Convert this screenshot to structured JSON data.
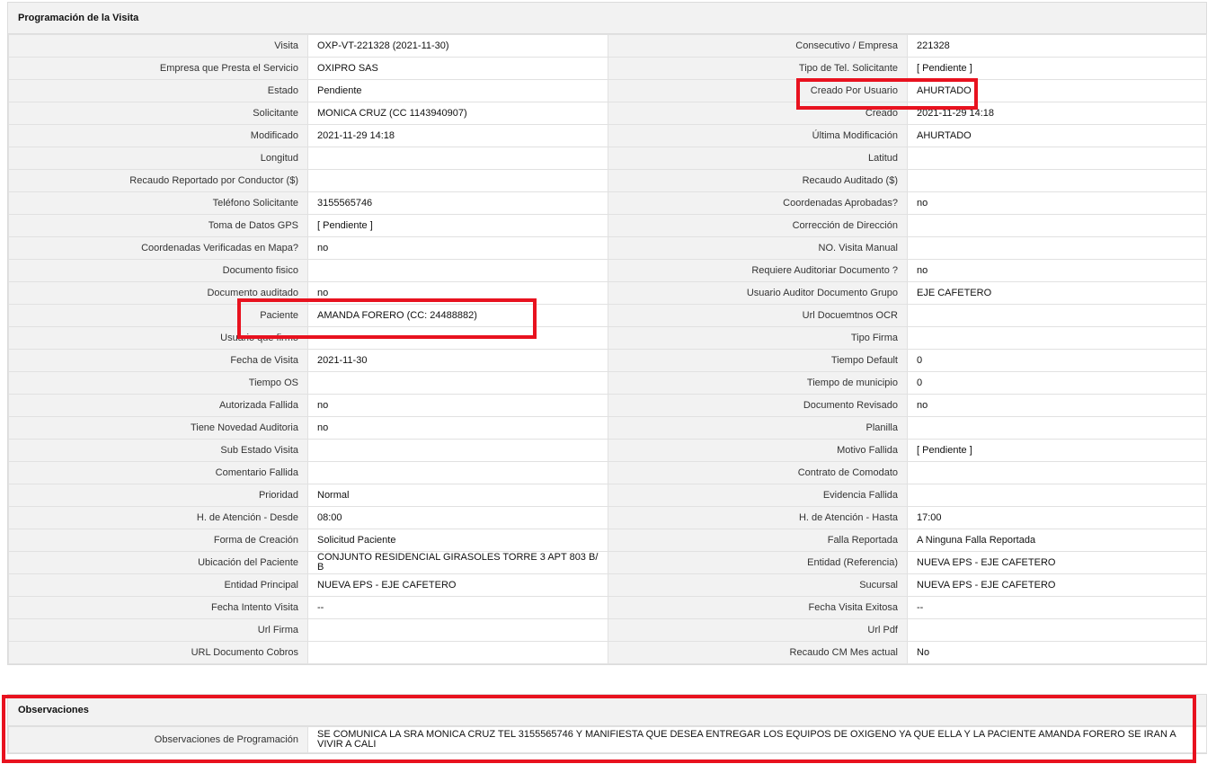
{
  "visit_panel": {
    "title": "Programación de la Visita",
    "rows": [
      {
        "l1": "Visita",
        "v1": "OXP-VT-221328 (2021-11-30)",
        "l2": "Consecutivo / Empresa",
        "v2": "221328"
      },
      {
        "l1": "Empresa que Presta el Servicio",
        "v1": "OXIPRO SAS",
        "l2": "Tipo de Tel. Solicitante",
        "v2": "[ Pendiente ]"
      },
      {
        "l1": "Estado",
        "v1": "Pendiente",
        "l2": "Creado Por Usuario",
        "v2": "AHURTADO"
      },
      {
        "l1": "Solicitante",
        "v1": "MONICA CRUZ (CC 1143940907)",
        "l2": "Creado",
        "v2": "2021-11-29 14:18"
      },
      {
        "l1": "Modificado",
        "v1": "2021-11-29 14:18",
        "l2": "Última Modificación",
        "v2": " AHURTADO"
      },
      {
        "l1": "Longitud",
        "v1": "",
        "l2": "Latitud",
        "v2": ""
      },
      {
        "l1": "Recaudo Reportado por Conductor ($)",
        "v1": "",
        "l2": "Recaudo Auditado ($)",
        "v2": ""
      },
      {
        "l1": "Teléfono Solicitante",
        "v1": "3155565746",
        "l2": "Coordenadas Aprobadas?",
        "v2": " no"
      },
      {
        "l1": "Toma de Datos GPS",
        "v1": "[ Pendiente ]",
        "l2": "Corrección de Dirección",
        "v2": ""
      },
      {
        "l1": "Coordenadas Verificadas en Mapa?",
        "v1": " no",
        "l2": "NO. Visita Manual",
        "v2": ""
      },
      {
        "l1": "Documento fisico",
        "v1": "",
        "l2": "Requiere Auditoriar Documento ?",
        "v2": " no"
      },
      {
        "l1": "Documento auditado",
        "v1": " no",
        "l2": "Usuario Auditor Documento Grupo",
        "v2": "EJE CAFETERO"
      },
      {
        "l1": "Paciente",
        "v1": "AMANDA FORERO (CC: 24488882)",
        "l2": "Url Docuemtnos OCR",
        "v2": ""
      },
      {
        "l1": "Usuario que firmo",
        "v1": "",
        "l2": "Tipo Firma",
        "v2": ""
      },
      {
        "l1": "Fecha de Visita",
        "v1": " 2021-11-30",
        "l2": "Tiempo Default",
        "v2": "0"
      },
      {
        "l1": "Tiempo OS",
        "v1": "",
        "l2": "Tiempo de municipio",
        "v2": "0"
      },
      {
        "l1": "Autorizada Fallida",
        "v1": " no",
        "l2": "Documento Revisado",
        "v2": " no"
      },
      {
        "l1": "Tiene Novedad Auditoria",
        "v1": " no",
        "l2": "Planilla",
        "v2": ""
      },
      {
        "l1": "Sub Estado Visita",
        "v1": "",
        "l2": "Motivo Fallida",
        "v2": "[ Pendiente ]"
      },
      {
        "l1": "Comentario Fallida",
        "v1": "",
        "l2": "Contrato de Comodato",
        "v2": ""
      },
      {
        "l1": "Prioridad",
        "v1": "Normal",
        "l2": "Evidencia Fallida",
        "v2": ""
      },
      {
        "l1": "H. de Atención - Desde",
        "v1": "08:00",
        "l2": "H. de Atención - Hasta",
        "v2": "17:00"
      },
      {
        "l1": "Forma de Creación",
        "v1": "Solicitud Paciente",
        "l2": "Falla Reportada",
        "v2": "A Ninguna Falla Reportada"
      },
      {
        "l1": "Ubicación del Paciente",
        "v1": "CONJUNTO RESIDENCIAL GIRASOLES TORRE 3 APT 803 B/ B",
        "l2": "Entidad (Referencia)",
        "v2": "NUEVA EPS - EJE CAFETERO"
      },
      {
        "l1": "Entidad Principal",
        "v1": "NUEVA EPS - EJE CAFETERO",
        "l2": "Sucursal",
        "v2": "NUEVA EPS - EJE CAFETERO"
      },
      {
        "l1": "Fecha Intento Visita",
        "v1": " --",
        "l2": "Fecha Visita Exitosa",
        "v2": " --"
      },
      {
        "l1": "Url Firma",
        "v1": "",
        "l2": "Url Pdf",
        "v2": ""
      },
      {
        "l1": "URL Documento Cobros",
        "v1": "",
        "l2": "Recaudo CM Mes actual",
        "v2": "No"
      }
    ]
  },
  "observations_panel": {
    "title": "Observaciones",
    "label": "Observaciones de Programación",
    "value": " SE COMUNICA LA SRA MONICA CRUZ TEL 3155565746 Y MANIFIESTA QUE DESEA ENTREGAR LOS EQUIPOS DE OXIGENO YA QUE ELLA Y LA PACIENTE AMANDA FORERO SE IRAN A VIVIR A CALI"
  },
  "colors": {
    "highlight": "#e8121f",
    "label_bg": "#f2f2f2",
    "value_bg": "#ffffff",
    "border": "#e1e1e1"
  }
}
